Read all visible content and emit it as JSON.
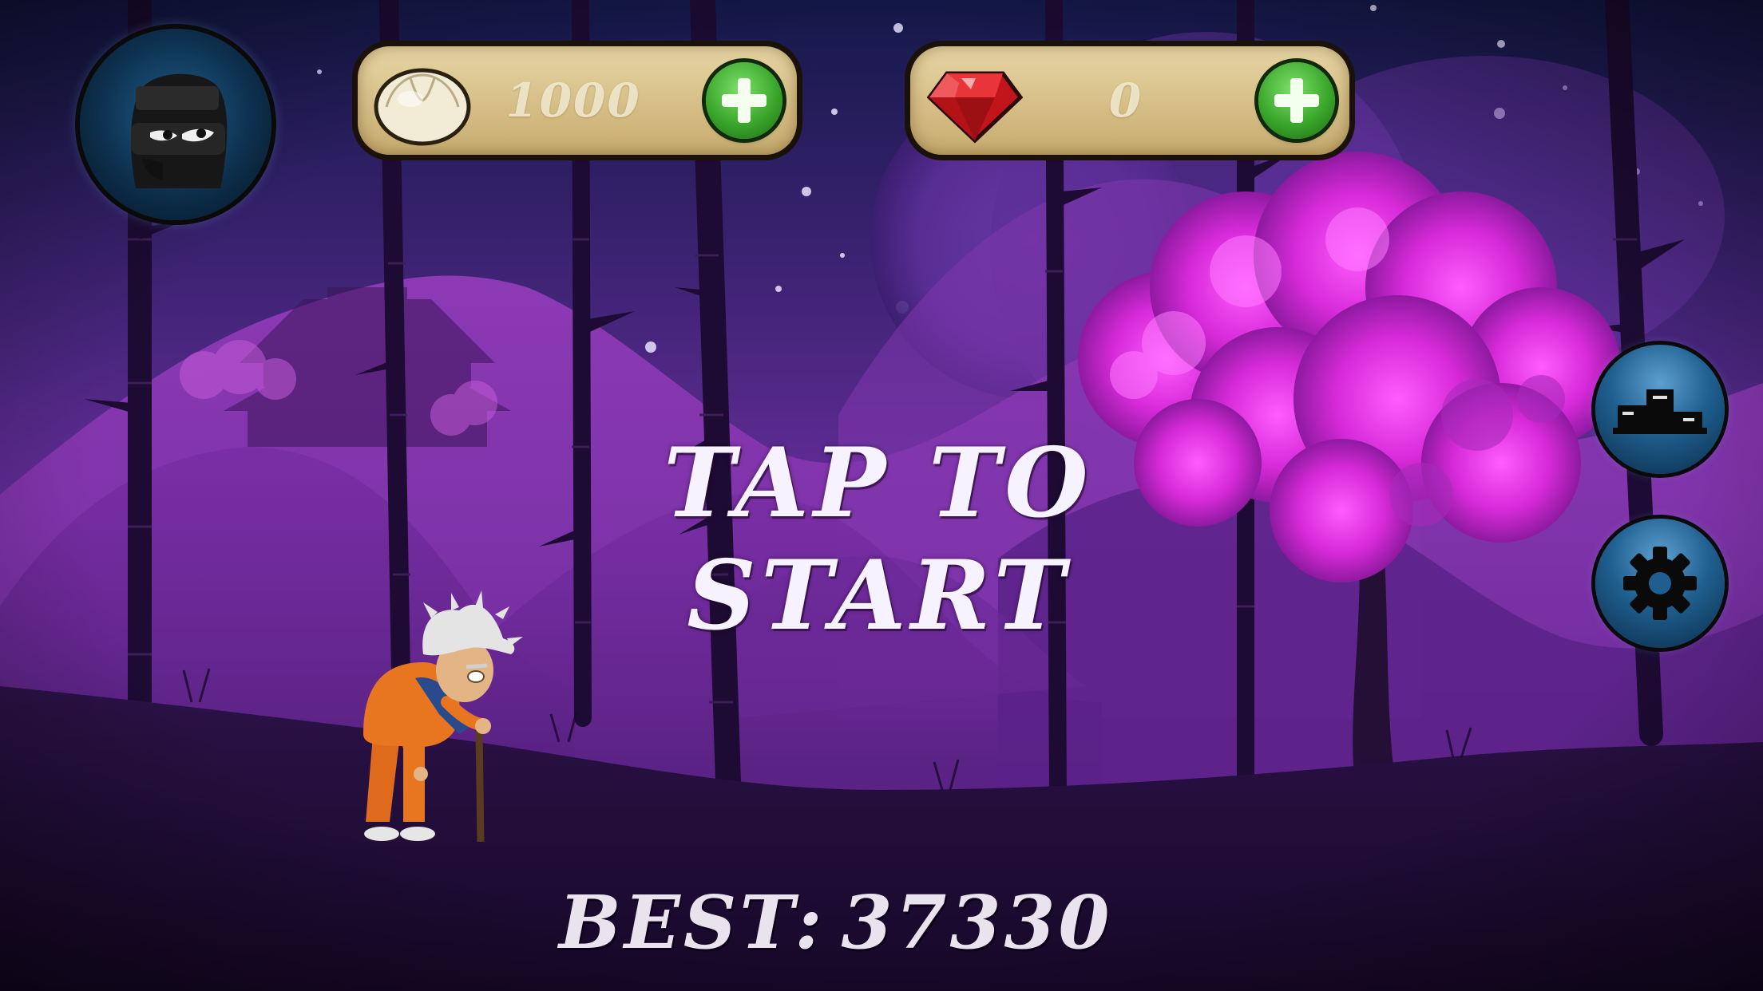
{
  "hud": {
    "coins": {
      "icon": "dumpling-icon",
      "value": "1000",
      "add_icon": "plus-icon"
    },
    "gems": {
      "icon": "ruby-gem-icon",
      "value": "0",
      "add_icon": "plus-icon"
    },
    "avatar_icon": "ninja-avatar-icon",
    "leaderboard_icon": "podium-icon",
    "settings_icon": "gear-icon"
  },
  "start_prompt": "TAP TO START",
  "best": {
    "label": "BEST:",
    "value": "37330"
  },
  "colors": {
    "sky_top": "#1a2258",
    "sky_mid": "#5a2a8e",
    "blossom": "#e233e6",
    "ground": "#2a1046",
    "button_blue": "#1f5f8f",
    "plus_green": "#3aa62b",
    "bar_tan": "#d7c089"
  }
}
